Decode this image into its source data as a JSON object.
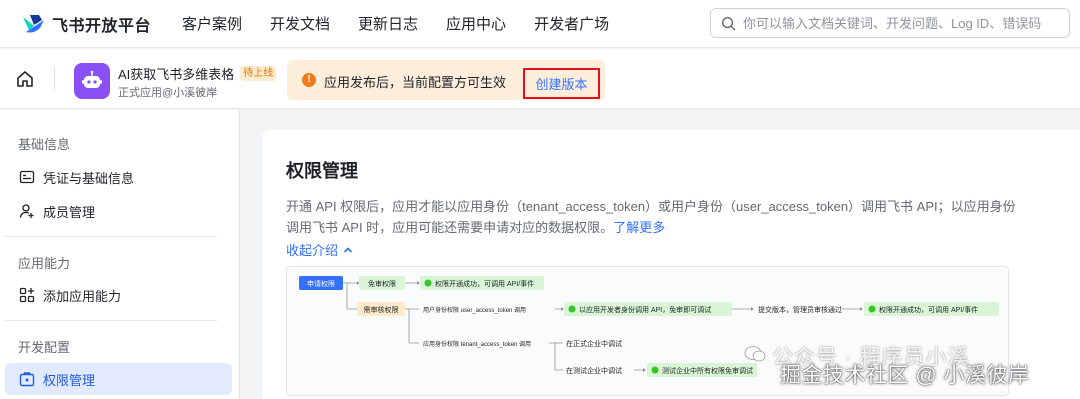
{
  "brand": {
    "name": "飞书开放平台"
  },
  "nav": {
    "items": [
      "客户案例",
      "开发文档",
      "更新日志",
      "应用中心",
      "开发者广场"
    ]
  },
  "search": {
    "placeholder": "你可以输入文档关键词、开发问题、Log ID、错误码",
    "icon": "search-icon"
  },
  "app": {
    "name": "AI获取飞书多维表格",
    "status_badge": "待上线",
    "subtitle": "正式应用@小溪彼岸",
    "icon": "robot-icon",
    "icon_color": "#8a4ff5"
  },
  "notice": {
    "text": "应用发布后，当前配置方可生效",
    "action_label": "创建版本",
    "highlight_color": "#e0101f"
  },
  "sidebar": {
    "sections": [
      {
        "title": "基础信息",
        "items": [
          {
            "label": "凭证与基础信息",
            "icon": "credential-icon"
          },
          {
            "label": "成员管理",
            "icon": "member-icon"
          }
        ]
      },
      {
        "title": "应用能力",
        "items": [
          {
            "label": "添加应用能力",
            "icon": "add-capability-icon"
          }
        ]
      },
      {
        "title": "开发配置",
        "items": [
          {
            "label": "权限管理",
            "icon": "permission-icon",
            "active": true
          }
        ]
      }
    ]
  },
  "main": {
    "title": "权限管理",
    "description": "开通 API 权限后，应用才能以应用身份（tenant_access_token）或用户身份（user_access_token）调用飞书 API；以应用身份调用飞书 API 时，应用可能还需要申请对应的数据权限。",
    "learn_more": "了解更多",
    "collapse_label": "收起介绍"
  },
  "diagram": {
    "apply": "申请权限",
    "free_review": "免审权限",
    "free_result": "权限开通成功，可调用 API/事件",
    "need_review": "需审核权限",
    "user_perm": "用户身份权限 user_access_token 调用",
    "debug_ok": "以应用开发者身份调用 API，免审即可调试",
    "submit": "提交版本，管理员审核通过",
    "final_result": "权限开通成功，可调用 API/事件",
    "app_perm": "应用身份权限 tenant_access_token 调用",
    "prod_debug": "在正式企业中调试",
    "test_debug": "在测试企业中调试",
    "test_ok": "测试企业中所有权限免审调试"
  },
  "watermarks": {
    "wechat": "公众号 · 程序员小溪",
    "juejin": "掘金技术社区 @ 小溪彼岸"
  },
  "colors": {
    "accent": "#3370ff",
    "active_bg": "#e1eaff",
    "notice_bg": "#fdeedc",
    "notice_icon": "#ef7b1a"
  }
}
